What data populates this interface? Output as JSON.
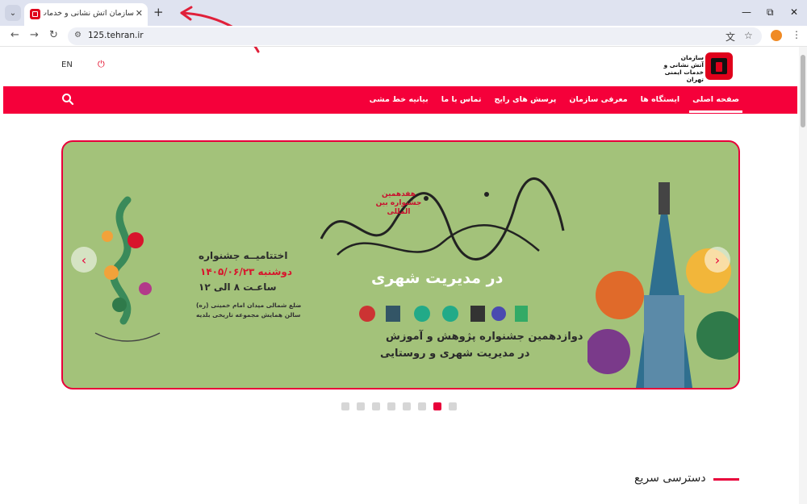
{
  "browser": {
    "tab_title": "سازمان آتش نشانی و خدمات ایم",
    "url": "125.tehran.ir",
    "icons": [
      "tab-list-icon",
      "favicon",
      "close-icon",
      "plus-icon",
      "minimize-icon",
      "restore-icon",
      "close-window-icon",
      "back-icon",
      "forward-icon",
      "reload-icon",
      "site-info-icon",
      "translate-icon",
      "star-icon",
      "extension-icon",
      "menu-icon"
    ]
  },
  "header": {
    "lang_label": "EN",
    "logo_lines": [
      "سازمان",
      "آتش نشانی و",
      "خدمات ایمنی تهران"
    ]
  },
  "nav": {
    "items": [
      "صفحه اصلی",
      "ایستگاه ها",
      "معرفی سازمان",
      "پرسش های رایج",
      "تماس با ما",
      "بیانیه خط مشی"
    ]
  },
  "slide": {
    "festival_label": "هفدهمین جشنواره بین المللی",
    "city_title": "در مدیریت شهری",
    "closing": "اختتامیــه جشنواره",
    "date": "دوشنبه ۱۴۰۵/۰۶/۲۳",
    "time": "ساعـت ۸ الی ۱۲",
    "location_1": "ضلع شمالی میدان امام خمینی (ره)",
    "location_2": "سالن همایش مجموعه تاریخی بلدیه",
    "subtitle_1": "دوازدهمین جشنواره پژوهش و آموزش",
    "subtitle_2": "در مدیریت شهری و روستایی"
  },
  "slider": {
    "dot_count": 8,
    "active_index": 6
  },
  "quick_access": {
    "title": "دسترسی سریع"
  },
  "colors": {
    "brand_red": "#f5003a",
    "slide_bg": "#a3c27a"
  }
}
